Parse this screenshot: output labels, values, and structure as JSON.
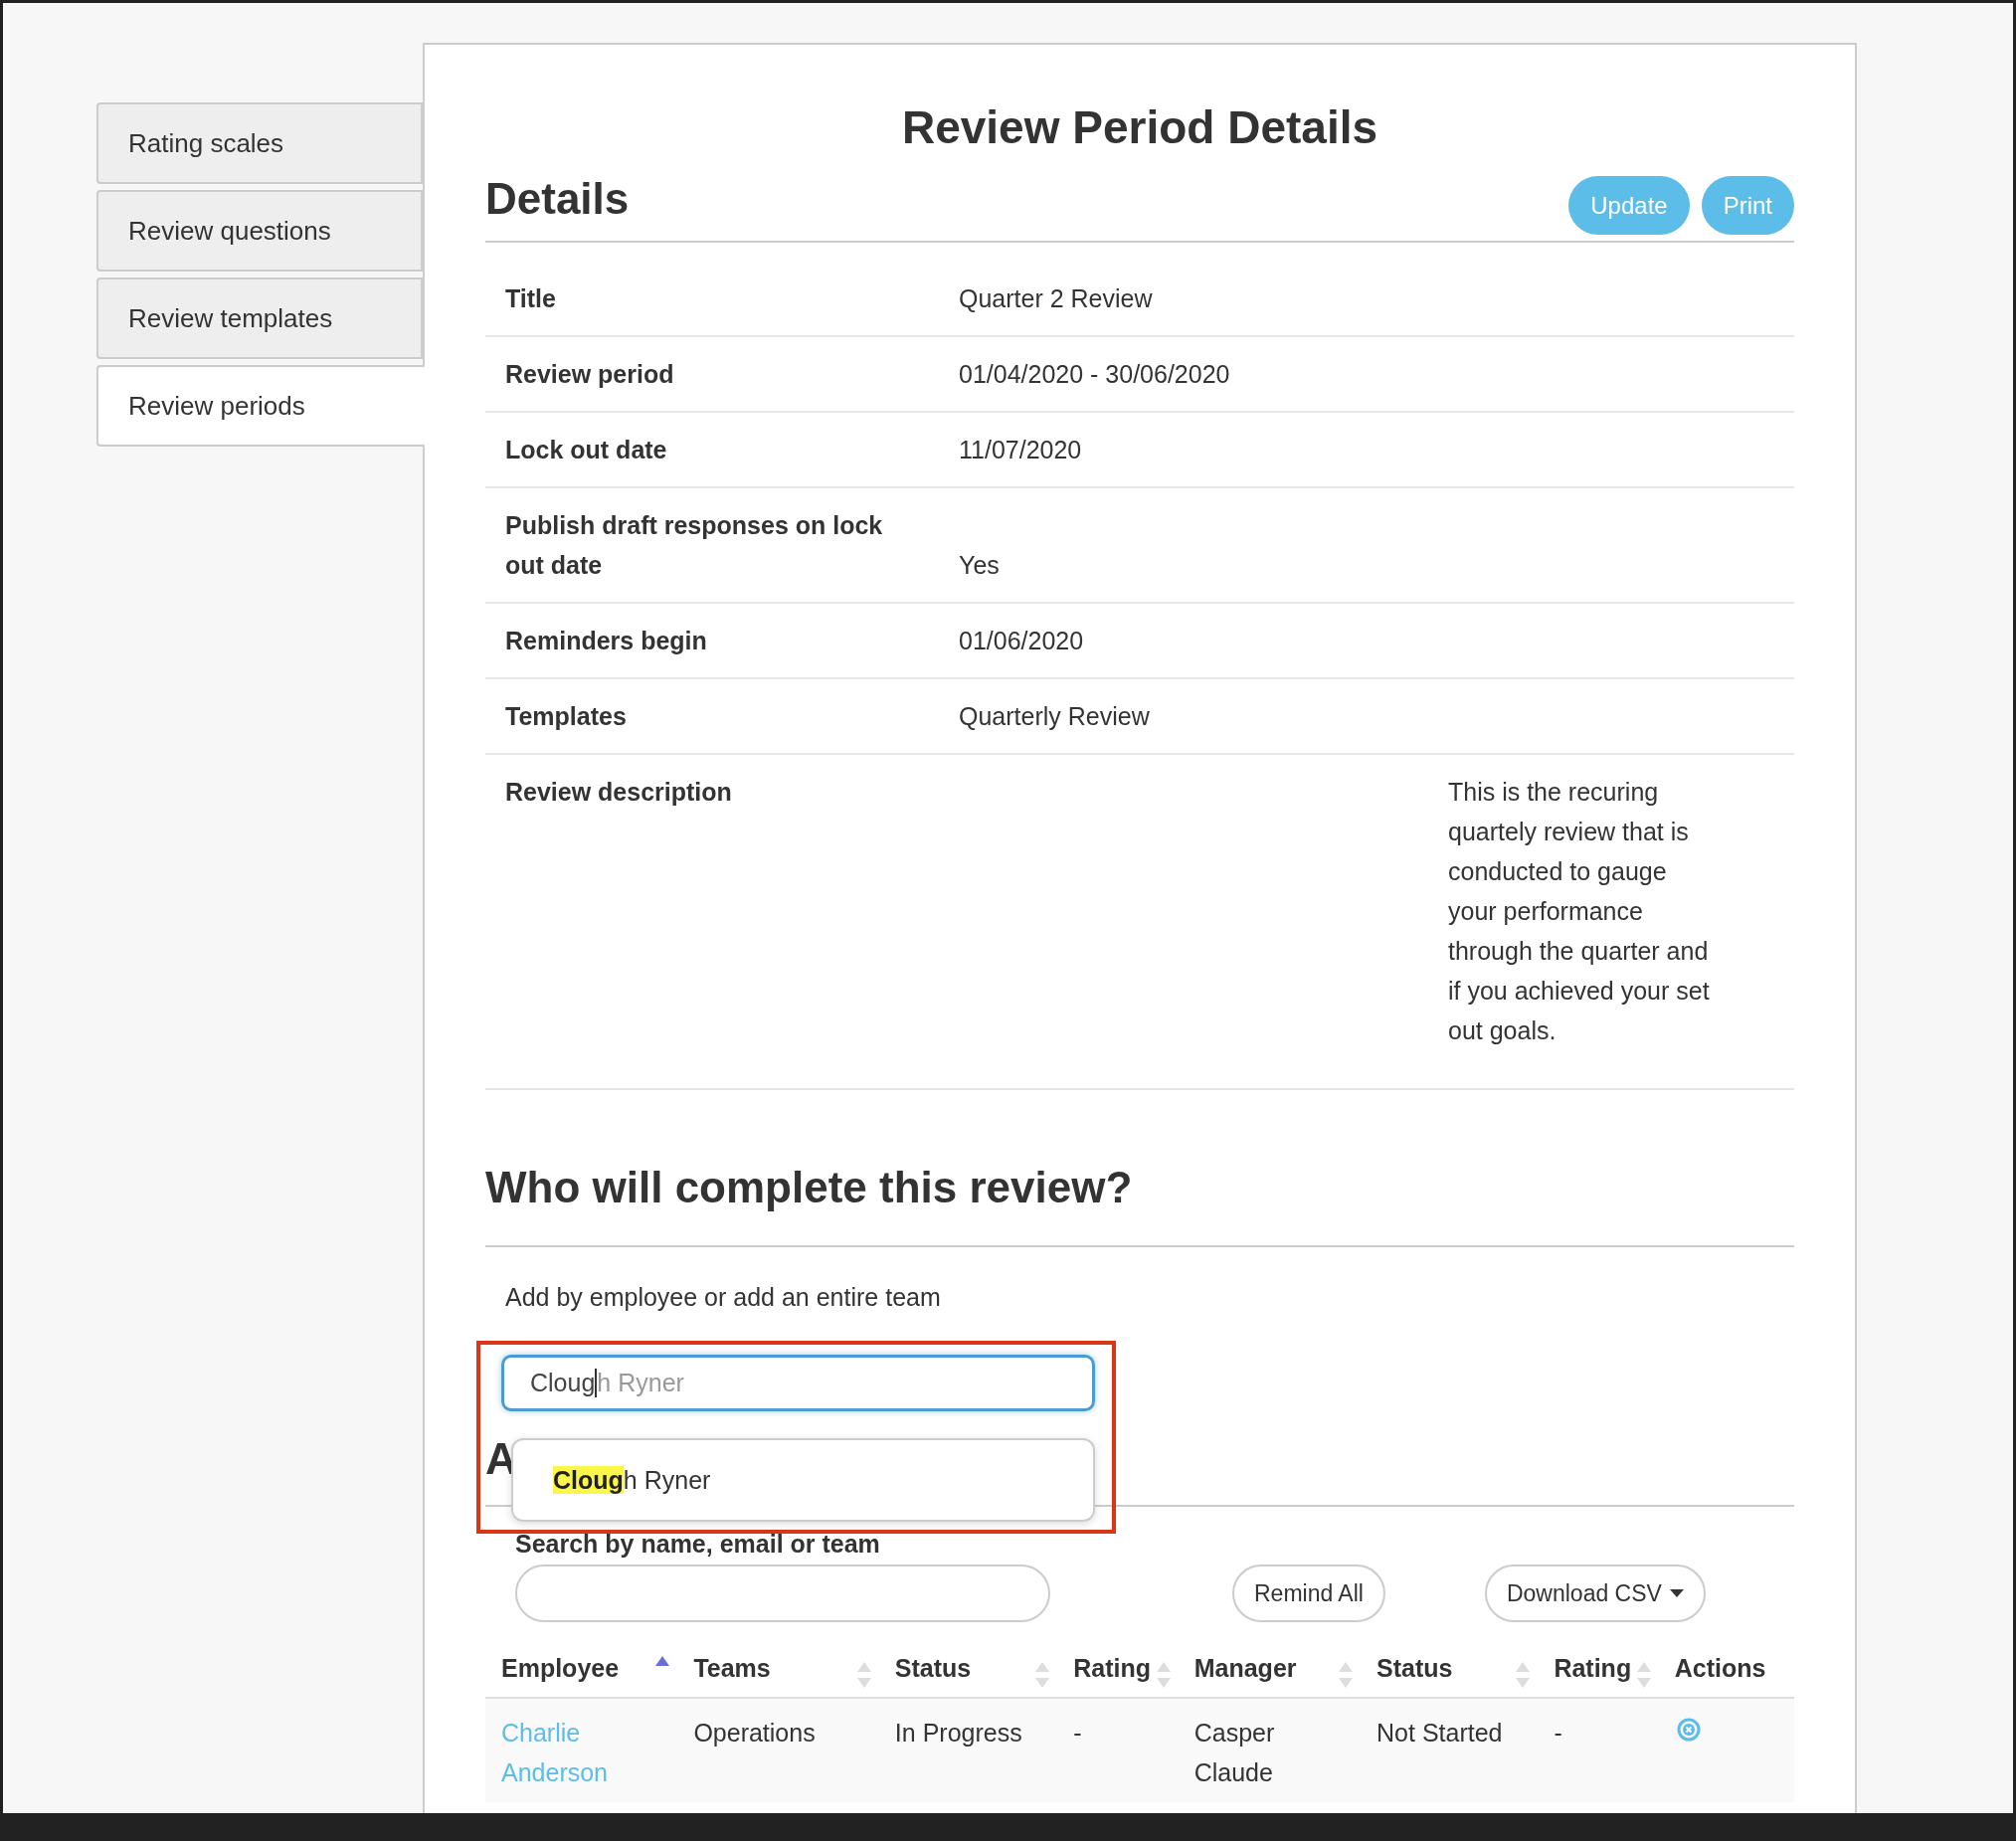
{
  "sidebar": {
    "items": [
      {
        "label": "Rating scales",
        "selected": false
      },
      {
        "label": "Review questions",
        "selected": false
      },
      {
        "label": "Review templates",
        "selected": false
      },
      {
        "label": "Review periods",
        "selected": true
      }
    ]
  },
  "page_title": "Review Period Details",
  "details": {
    "heading": "Details",
    "buttons": [
      "Update",
      "Print"
    ],
    "rows": [
      {
        "kind": "field",
        "label": "Title",
        "value": "Quarter 2 Review"
      },
      {
        "kind": "field",
        "label": "Review period",
        "value": "01/04/2020 - 30/06/2020"
      },
      {
        "kind": "field",
        "label": "Lock out date",
        "value": "11/07/2020"
      },
      {
        "kind": "field",
        "label": "Publish draft responses on lock out date",
        "value": "Yes"
      },
      {
        "kind": "field",
        "label": "Reminders begin",
        "value": "01/06/2020"
      },
      {
        "kind": "field",
        "label": "Templates",
        "value": "Quarterly Review"
      },
      {
        "kind": "description",
        "label": "Review description",
        "value": "This is the recuring quartely review that is conducted to gauge your performance through the quarter and if you achieved your set out goals."
      }
    ]
  },
  "assignment": {
    "heading": "Who will complete this review?",
    "hint": "Add by employee or add an entire team",
    "field": {
      "value": "Cloug",
      "completion": "h Ryner"
    },
    "suggestions": [
      {
        "match": "Cloug",
        "rest": "h Ryner"
      }
    ]
  },
  "assigned": {
    "heading": "A",
    "search_label": "Search by name, email or team",
    "buttons": [
      {
        "label": "Remind All",
        "kind": "plain"
      },
      {
        "label": "Download CSV",
        "kind": "dropdown"
      }
    ]
  },
  "table": {
    "columns": [
      {
        "label": "Employee",
        "kind": "sorted"
      },
      {
        "label": "Teams",
        "kind": "sortable"
      },
      {
        "label": "Status",
        "kind": "sortable"
      },
      {
        "label": "Rating",
        "kind": "sortable"
      },
      {
        "label": "Manager",
        "kind": "sortable"
      },
      {
        "label": "Status",
        "kind": "sortable"
      },
      {
        "label": "Rating",
        "kind": "sortable"
      },
      {
        "label": "Actions",
        "kind": "plain"
      }
    ],
    "rows": [
      {
        "employee": "Charlie Anderson",
        "teams": "Operations",
        "status": "In Progress",
        "rating": "-",
        "manager": "Casper Claude",
        "manager_status": "Not Started",
        "manager_rating": "-"
      }
    ]
  }
}
